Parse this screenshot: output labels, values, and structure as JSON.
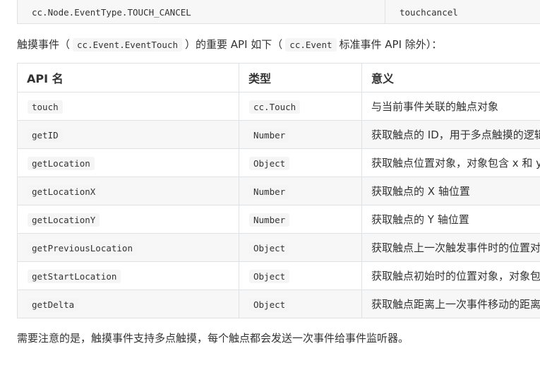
{
  "top_row": {
    "col1": "cc.Node.EventType.TOUCH_CANCEL",
    "col2": "touchcancel"
  },
  "intro": {
    "text_before": "触摸事件（",
    "code1": "cc.Event.EventTouch",
    "text_middle": "）的重要 API 如下（",
    "code2": "cc.Event",
    "text_after": "标准事件 API 除外）："
  },
  "table": {
    "headers": [
      "API 名",
      "类型",
      "意义"
    ],
    "rows": [
      {
        "api": "touch",
        "type": "cc.Touch",
        "meaning": "与当前事件关联的触点对象"
      },
      {
        "api": "getID",
        "type": "Number",
        "meaning": "获取触点的 ID，用于多点触摸的逻辑判断"
      },
      {
        "api": "getLocation",
        "type": "Object",
        "meaning": "获取触点位置对象，对象包含 x 和 y 属性"
      },
      {
        "api": "getLocationX",
        "type": "Number",
        "meaning": "获取触点的 X 轴位置"
      },
      {
        "api": "getLocationY",
        "type": "Number",
        "meaning": "获取触点的 Y 轴位置"
      },
      {
        "api": "getPreviousLocation",
        "type": "Object",
        "meaning": "获取触点上一次触发事件时的位置对象"
      },
      {
        "api": "getStartLocation",
        "type": "Object",
        "meaning": "获取触点初始时的位置对象，对象包含 x 和 y 属性"
      },
      {
        "api": "getDelta",
        "type": "Object",
        "meaning": "获取触点距离上一次事件移动的距离对象"
      }
    ]
  },
  "footer": {
    "text": "需要注意的是，触摸事件支持多点触摸，每个触点都会发送一次事件给事件监听器。"
  }
}
